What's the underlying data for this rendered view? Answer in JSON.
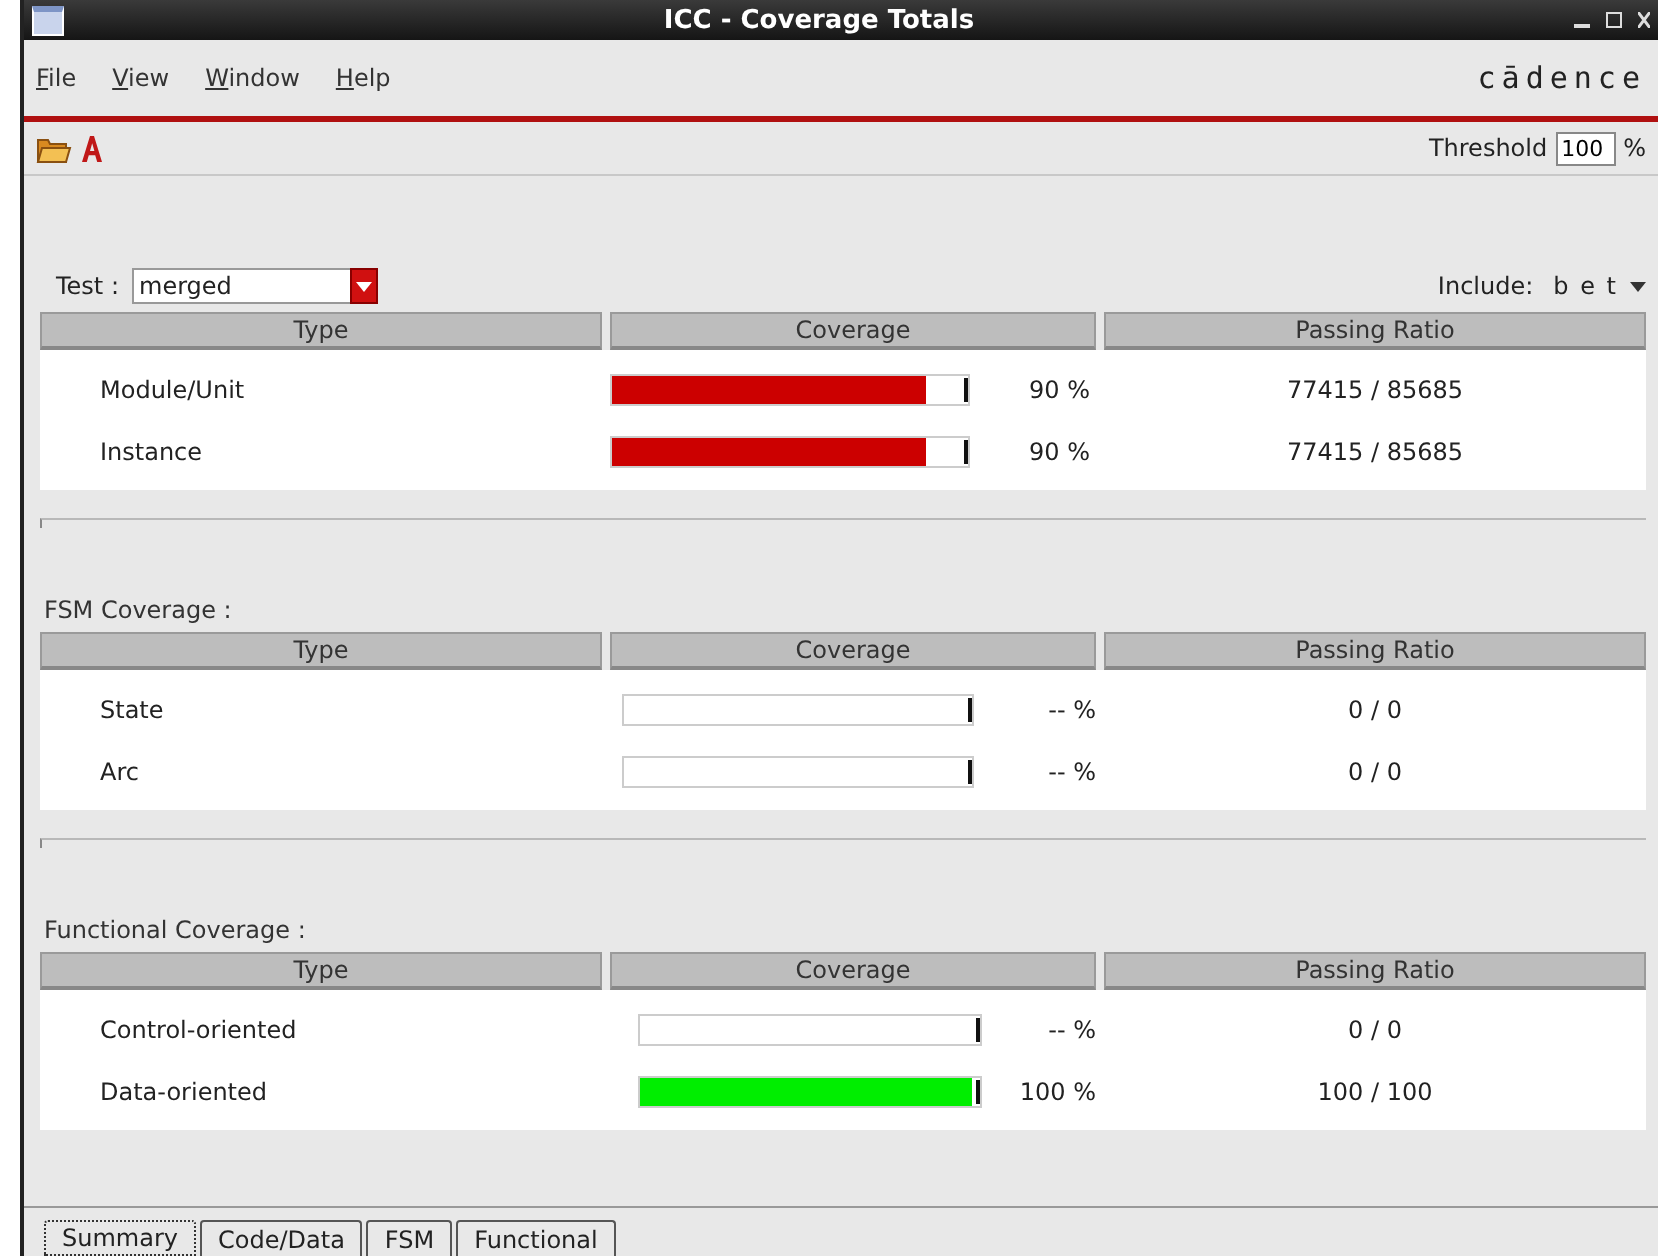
{
  "window": {
    "title": "ICC - Coverage Totals"
  },
  "menu": [
    "File",
    "View",
    "Window",
    "Help"
  ],
  "brand": "cādence",
  "threshold": {
    "label": "Threshold",
    "value": "100",
    "unit": "%"
  },
  "test": {
    "label": "Test :",
    "value": "merged"
  },
  "include": {
    "label": "Include:",
    "value": "b e t"
  },
  "sections": [
    {
      "columns": [
        "Type",
        "Coverage",
        "Passing Ratio"
      ],
      "rows": [
        {
          "type": "Module/Unit",
          "level": 0.9,
          "color": "#cc0000",
          "percent": "90 %",
          "ratio": "77415 / 85685"
        },
        {
          "type": "Instance",
          "level": 0.9,
          "color": "#cc0000",
          "percent": "90 %",
          "ratio": "77415 / 85685"
        }
      ]
    },
    {
      "title": "FSM Coverage :",
      "columns": [
        "Type",
        "Coverage",
        "Passing Ratio"
      ],
      "rows": [
        {
          "type": "State",
          "level": 0,
          "percent": "-- %",
          "ratio": "0 / 0"
        },
        {
          "type": "Arc",
          "level": 0,
          "percent": "-- %",
          "ratio": "0 / 0"
        }
      ]
    },
    {
      "title": "Functional Coverage :",
      "columns": [
        "Type",
        "Coverage",
        "Passing Ratio"
      ],
      "rows": [
        {
          "type": "Control-oriented",
          "level": 0,
          "percent": "-- %",
          "ratio": "0 / 0"
        },
        {
          "type": "Data-oriented",
          "level": 1,
          "color": "#00ee00",
          "percent": "100 %",
          "ratio": "100 / 100"
        }
      ]
    }
  ],
  "tabs": [
    {
      "label": "Summary",
      "selected": true
    },
    {
      "label": "Code/Data",
      "selected": false
    },
    {
      "label": "FSM",
      "selected": false
    },
    {
      "label": "Functional",
      "selected": false
    }
  ]
}
